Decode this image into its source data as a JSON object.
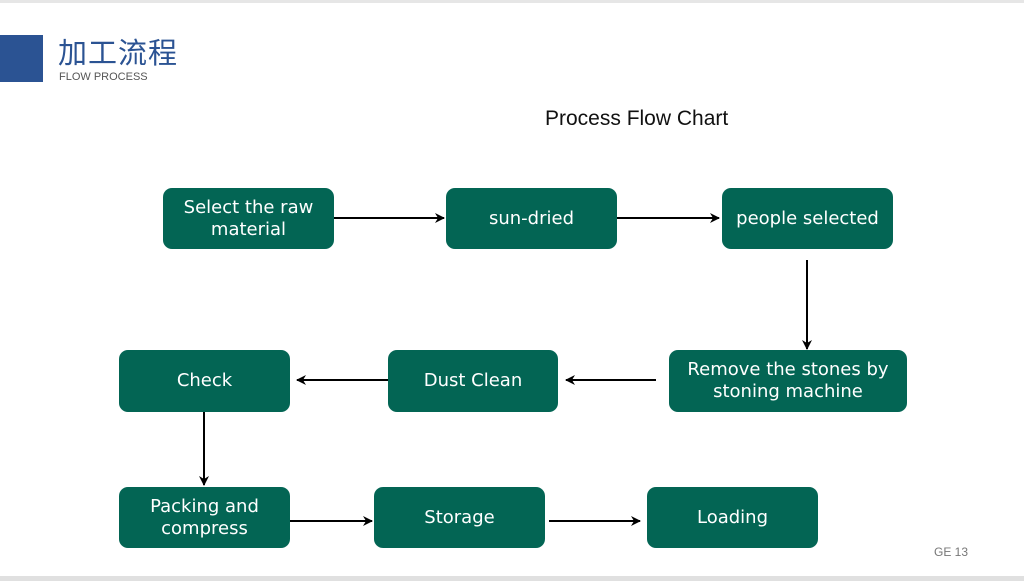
{
  "header": {
    "title": "加工流程",
    "subtitle": "FLOW PROCESS"
  },
  "diagram": {
    "title": "Process Flow Chart",
    "steps": [
      {
        "id": "select-raw-material",
        "label": "Select the raw material"
      },
      {
        "id": "sun-dried",
        "label": "sun-dried"
      },
      {
        "id": "people-selected",
        "label": "people selected"
      },
      {
        "id": "remove-stones",
        "label": "Remove the stones by stoning machine"
      },
      {
        "id": "dust-clean",
        "label": "Dust Clean"
      },
      {
        "id": "check",
        "label": "Check"
      },
      {
        "id": "packing-compress",
        "label": "Packing and compress"
      },
      {
        "id": "storage",
        "label": "Storage"
      },
      {
        "id": "loading",
        "label": "Loading"
      }
    ],
    "box_color": "#036554"
  },
  "footer": {
    "page_label": "GE 13"
  }
}
